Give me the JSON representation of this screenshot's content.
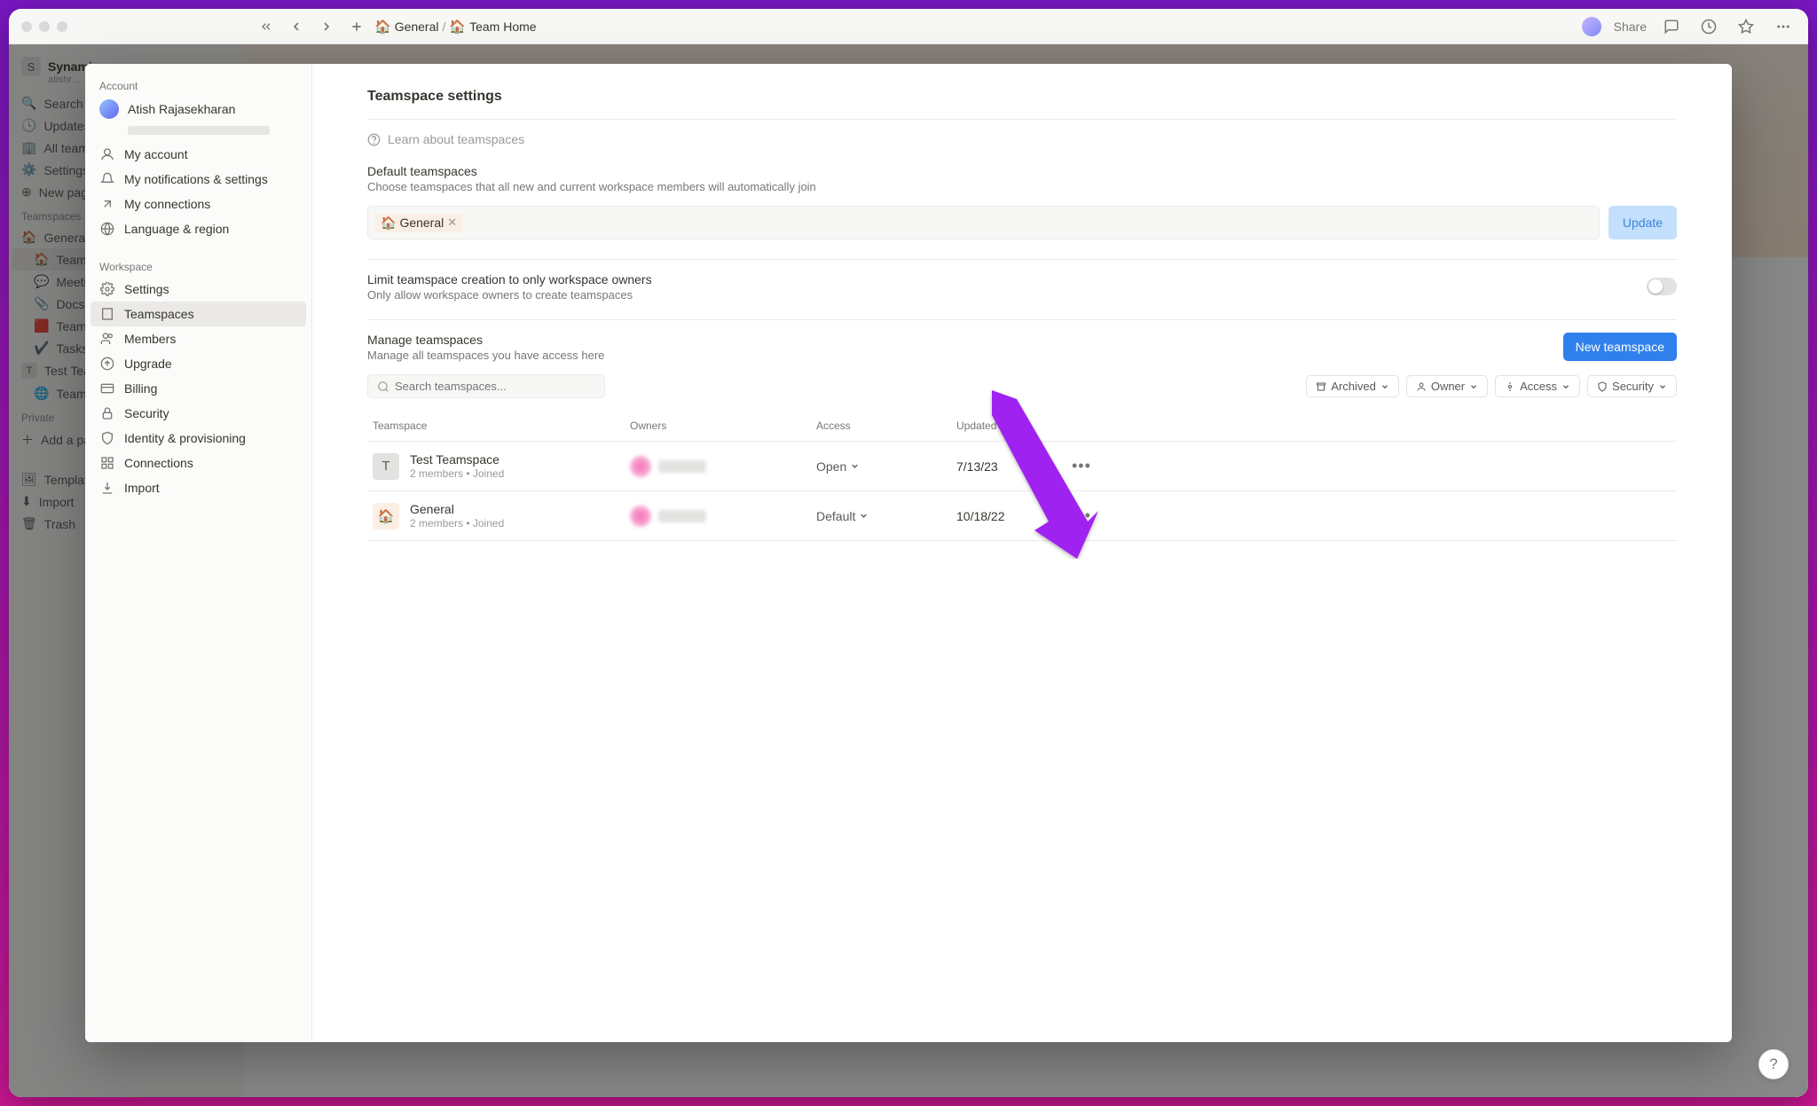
{
  "topbar": {
    "breadcrumb_space_emoji": "🏠",
    "breadcrumb_space": "General",
    "sep": "/",
    "breadcrumb_page_emoji": "🏠",
    "breadcrumb_page": "Team Home",
    "share": "Share"
  },
  "bg_sidebar": {
    "workspace_initial": "S",
    "workspace_name": "Synamic",
    "workspace_sub": "atishr…",
    "items_top": [
      "Search",
      "Updates",
      "All teamspaces",
      "Settings & members",
      "New page"
    ],
    "teamspaces_label": "Teamspaces",
    "teamspaces": [
      "General",
      "Team Home",
      "Meeting Notes",
      "Docs",
      "Team Tasks",
      "Tasks"
    ],
    "test_team": "Test Teamspace",
    "test_team_sub": "Team Home",
    "private_label": "Private",
    "add_page": "Add a page",
    "bottom": [
      "Templates",
      "Import",
      "Trash"
    ]
  },
  "modal_side": {
    "account_label": "Account",
    "user_name": "Atish Rajasekharan",
    "account_items": [
      "My account",
      "My notifications & settings",
      "My connections",
      "Language & region"
    ],
    "workspace_label": "Workspace",
    "workspace_items": [
      "Settings",
      "Teamspaces",
      "Members",
      "Upgrade",
      "Billing",
      "Security",
      "Identity & provisioning",
      "Connections",
      "Import"
    ]
  },
  "modal": {
    "title": "Teamspace settings",
    "learn": "Learn about teamspaces",
    "default_h": "Default teamspaces",
    "default_sub": "Choose teamspaces that all new and current workspace members will automatically join",
    "tag_emoji": "🏠",
    "tag_name": "General",
    "update": "Update",
    "limit_h": "Limit teamspace creation to only workspace owners",
    "limit_sub": "Only allow workspace owners to create teamspaces",
    "manage_h": "Manage teamspaces",
    "manage_sub": "Manage all teamspaces you have access here",
    "new_btn": "New teamspace",
    "search_placeholder": "Search teamspaces...",
    "filters": {
      "archived": "Archived",
      "owner": "Owner",
      "access": "Access",
      "security": "Security"
    },
    "cols": {
      "ts": "Teamspace",
      "owners": "Owners",
      "access": "Access",
      "updated": "Updated"
    },
    "rows": [
      {
        "icon_type": "letter",
        "icon": "T",
        "name": "Test Teamspace",
        "meta": "2 members  •  Joined",
        "access": "Open",
        "updated": "7/13/23"
      },
      {
        "icon_type": "emoji",
        "icon": "🏠",
        "name": "General",
        "meta": "2 members  •  Joined",
        "access": "Default",
        "updated": "10/18/22"
      }
    ]
  }
}
